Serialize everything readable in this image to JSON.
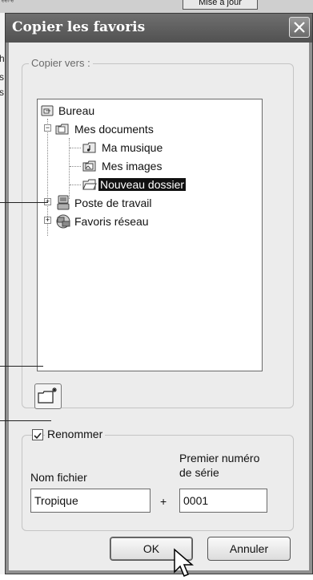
{
  "background": {
    "top_button_label": "Mise à jour",
    "left_fragments": [
      "he",
      "s",
      "s"
    ]
  },
  "dialog": {
    "title": "Copier les favoris",
    "copy_to_group_label": "Copier vers :",
    "tree": [
      {
        "label": "Bureau",
        "icon": "desktop-icon",
        "level": 0,
        "expander": null,
        "selected": false
      },
      {
        "label": "Mes documents",
        "icon": "my-documents-icon",
        "level": 1,
        "expander": "−",
        "selected": false
      },
      {
        "label": "Ma musique",
        "icon": "my-music-icon",
        "level": 2,
        "expander": null,
        "selected": false
      },
      {
        "label": "Mes images",
        "icon": "my-pictures-icon",
        "level": 2,
        "expander": null,
        "selected": false
      },
      {
        "label": "Nouveau dossier",
        "icon": "folder-icon",
        "level": 2,
        "expander": null,
        "selected": true
      },
      {
        "label": "Poste de travail",
        "icon": "my-computer-icon",
        "level": 1,
        "expander": "+",
        "selected": false
      },
      {
        "label": "Favoris réseau",
        "icon": "network-places-icon",
        "level": 1,
        "expander": "+",
        "selected": false
      }
    ],
    "rename": {
      "checkbox_label": "Renommer",
      "checked": true,
      "filename_label": "Nom fichier",
      "serial_label_line1": "Premier numéro",
      "serial_label_line2": "de série",
      "filename_value": "Tropique",
      "plus": "+",
      "serial_value": "0001"
    },
    "buttons": {
      "ok": "OK",
      "cancel": "Annuler"
    }
  }
}
